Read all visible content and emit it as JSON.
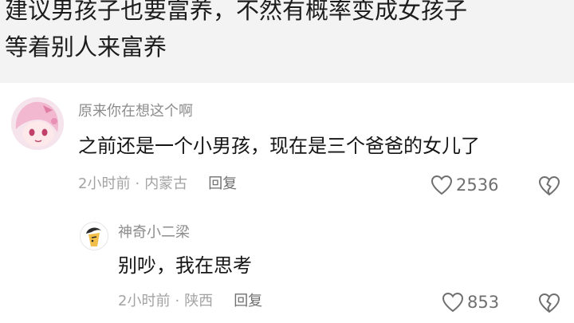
{
  "post": {
    "line1": "建议男孩子也要富养，不然有概率变成女孩子",
    "line2": "等着别人来富养"
  },
  "comments": [
    {
      "username": "原来你在想这个啊",
      "content": "之前还是一个小男孩，现在是三个爸爸的女儿了",
      "time": "2小时前",
      "location": "内蒙古",
      "reply_label": "回复",
      "likes": "2536"
    },
    {
      "username": "神奇小二梁",
      "content": "别吵，我在思考",
      "time": "2小时前",
      "location": "陕西",
      "reply_label": "回复",
      "likes": "853"
    }
  ],
  "separator": "·",
  "colors": {
    "post_background": "#f3f3f3",
    "username": "#8c8c8c",
    "meta": "#a3a3a3",
    "icon": "#6f6f6f"
  },
  "icons": {
    "like": "heart-outline-icon",
    "dislike": "broken-heart-icon"
  }
}
